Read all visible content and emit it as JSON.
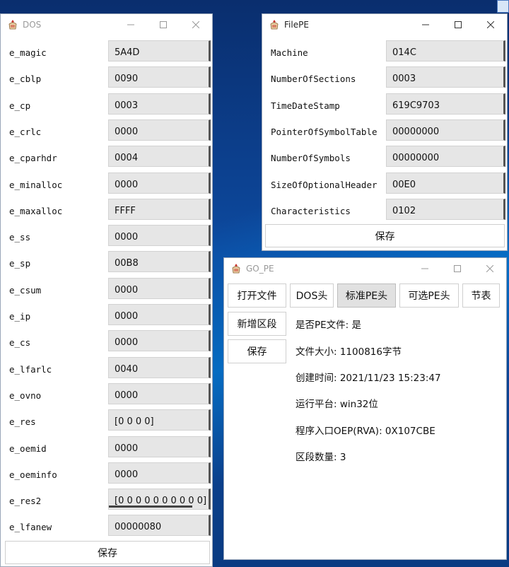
{
  "dos_window": {
    "title": "DOS",
    "fields": [
      {
        "label": "e_magic",
        "value": "5A4D"
      },
      {
        "label": "e_cblp",
        "value": "0090"
      },
      {
        "label": "e_cp",
        "value": "0003"
      },
      {
        "label": "e_crlc",
        "value": "0000"
      },
      {
        "label": "e_cparhdr",
        "value": "0004"
      },
      {
        "label": "e_minalloc",
        "value": "0000"
      },
      {
        "label": "e_maxalloc",
        "value": "FFFF"
      },
      {
        "label": "e_ss",
        "value": "0000"
      },
      {
        "label": "e_sp",
        "value": "00B8"
      },
      {
        "label": "e_csum",
        "value": "0000"
      },
      {
        "label": "e_ip",
        "value": "0000"
      },
      {
        "label": "e_cs",
        "value": "0000"
      },
      {
        "label": "e_lfarlc",
        "value": "0040"
      },
      {
        "label": "e_ovno",
        "value": "0000"
      },
      {
        "label": "e_res",
        "value": "[0 0 0 0]"
      },
      {
        "label": "e_oemid",
        "value": "0000"
      },
      {
        "label": "e_oeminfo",
        "value": "0000"
      },
      {
        "label": "e_res2",
        "value": "[0 0 0 0 0 0 0 0 0 0]"
      },
      {
        "label": "e_lfanew",
        "value": "00000080"
      }
    ],
    "save_label": "保存"
  },
  "filepe_window": {
    "title": "FilePE",
    "fields": [
      {
        "label": "Machine",
        "value": "014C"
      },
      {
        "label": "NumberOfSections",
        "value": "0003"
      },
      {
        "label": "TimeDateStamp",
        "value": "619C9703"
      },
      {
        "label": "PointerOfSymbolTable",
        "value": "00000000"
      },
      {
        "label": "NumberOfSymbols",
        "value": "00000000"
      },
      {
        "label": "SizeOfOptionalHeader",
        "value": "00E0"
      },
      {
        "label": "Characteristics",
        "value": "0102"
      }
    ],
    "save_label": "保存"
  },
  "gope_window": {
    "title": "GO_PE",
    "toolbar": [
      "打开文件",
      "DOS头",
      "标准PE头",
      "可选PE头",
      "节表"
    ],
    "active_tab": "标准PE头",
    "side_buttons": [
      "新增区段",
      "保存"
    ],
    "info": [
      "是否PE文件: 是",
      "文件大小: 1100816字节",
      "创建时间: 2021/11/23 15:23:47",
      "运行平台: win32位",
      "程序入口OEP(RVA): 0X107CBE",
      "区段数量: 3"
    ]
  }
}
